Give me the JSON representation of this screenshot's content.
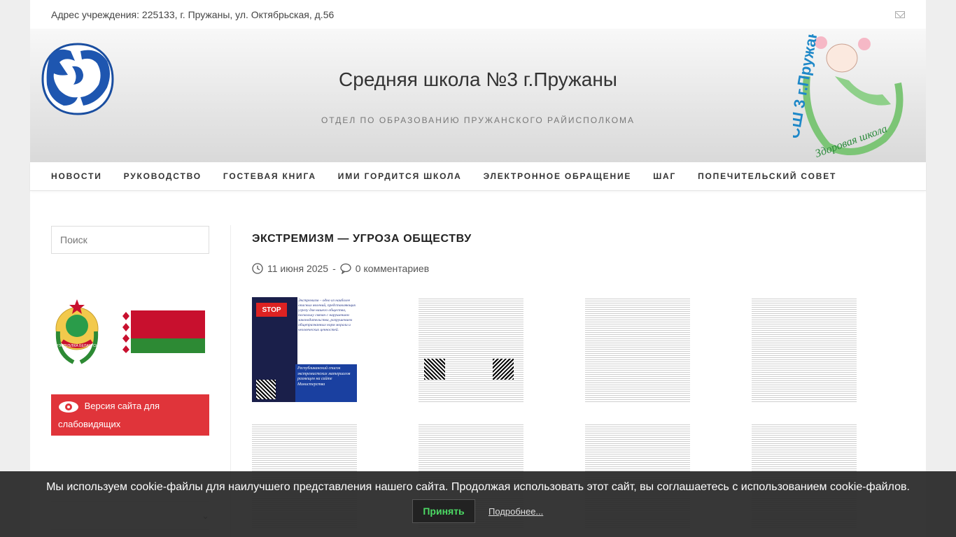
{
  "topbar": {
    "address": "Адрес учреждения: 225133, г. Пружаны, ул. Октябрьская, д.56",
    "mail_icon": "mail-icon"
  },
  "header": {
    "title": "Средняя школа №3 г.Пружаны",
    "subtitle": "ОТДЕЛ ПО ОБРАЗОВАНИЮ ПРУЖАНСКОГО РАЙИСПОЛКОМА",
    "logo_text": "СШ 3 г.Пружаны",
    "logo_slogan": "Здоровая школа"
  },
  "nav": {
    "items": [
      "НОВОСТИ",
      "РУКОВОДСТВО",
      "ГОСТЕВАЯ КНИГА",
      "ИМИ ГОРДИТСЯ ШКОЛА",
      "ЭЛЕКТРОННОЕ ОБРАЩЕНИЕ",
      "ШАГ",
      "ПОПЕЧИТЕЛЬСКИЙ СОВЕТ"
    ]
  },
  "sidebar": {
    "search_placeholder": "Поиск",
    "emblem_text": "РЭСПУБЛІКА БЕЛАРУСЬ",
    "vision_label_1": "Версия сайта для",
    "vision_label_2": "слабовидящих",
    "links": [
      "",
      "",
      ""
    ]
  },
  "post": {
    "title": "ЭКСТРЕМИЗМ — УГРОЗА ОБЩЕСТВУ",
    "date": "11 июня 2025",
    "comments": "0 комментариев",
    "poster": {
      "stop": "STOP",
      "quote": "Экстремизм – одно из наиболее опасных явлений, представляющих угрозу для нашего общества, поскольку связан с нарушением законодательства, разрушением общепризнанных норм морали и человеческих ценностей.",
      "banner": "Республиканский список экстремистских материалов размещен на сайте Министерства"
    }
  },
  "cookie": {
    "message": "Мы используем cookie-файлы для наилучшего представления нашего сайта. Продолжая использовать этот сайт, вы соглашаетесь с использованием cookie-файлов.",
    "accept": "Принять",
    "more": "Подробнее..."
  },
  "colors": {
    "accent_red": "#e0343a",
    "accept_green": "#4cd964"
  }
}
